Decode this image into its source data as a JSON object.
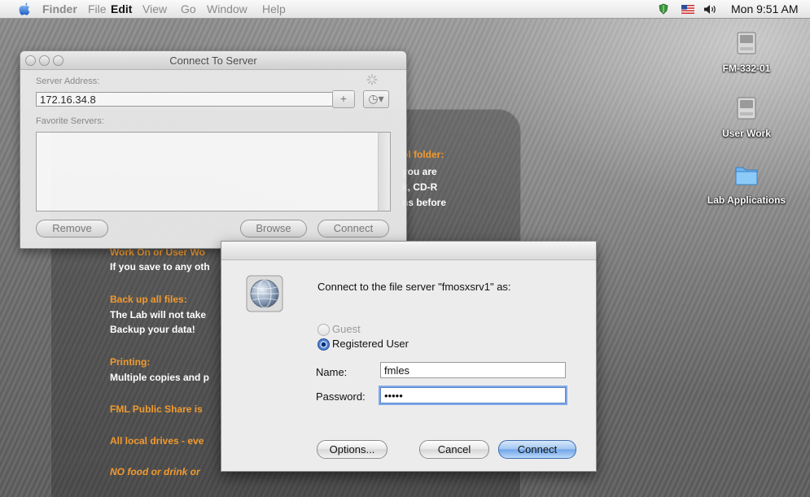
{
  "menubar": {
    "app": "Finder",
    "items": [
      "File",
      "Edit",
      "View",
      "Go",
      "Window",
      "Help"
    ],
    "clock": "Mon 9:51 AM"
  },
  "desktop_icons": [
    {
      "label": "FM-332-01",
      "icon": "hard-drive-icon"
    },
    {
      "label": "User Work",
      "icon": "hard-drive-icon"
    },
    {
      "label": "Lab Applications",
      "icon": "folder-icon"
    }
  ],
  "background_notes": {
    "line1": "ol folder:",
    "line2": "you are",
    "line3": "k, CD-R",
    "line4": "ns before",
    "work_heading": "Work On or User Wo",
    "work_body": "If you save to any oth",
    "backup_heading": "Back up all files:",
    "backup_body1": "The Lab will not take",
    "backup_body2": "Backup your data!",
    "printing_heading": "Printing:",
    "printing_body": "Multiple copies and p",
    "share_heading": "FML Public Share is",
    "drives_heading": "All local drives - eve",
    "food_heading": "NO food or drink or"
  },
  "connect_to_server": {
    "title": "Connect To Server",
    "server_address_label": "Server Address:",
    "server_address_value": "172.16.34.8",
    "add_button": "+",
    "recent_button": "◷▾",
    "favorites_label": "Favorite Servers:",
    "remove_button": "Remove",
    "browse_button": "Browse",
    "connect_button": "Connect"
  },
  "auth_dialog": {
    "message": "Connect to the file server \"fmosxsrv1\" as:",
    "guest_label": "Guest",
    "registered_label": "Registered User",
    "selected": "Registered User",
    "name_label": "Name:",
    "name_value": "fmles",
    "password_label": "Password:",
    "password_value": "•••••",
    "options_button": "Options...",
    "cancel_button": "Cancel",
    "connect_button": "Connect"
  },
  "colors": {
    "accent_blue": "#6fa5e8",
    "note_orange": "#f29a2e"
  }
}
